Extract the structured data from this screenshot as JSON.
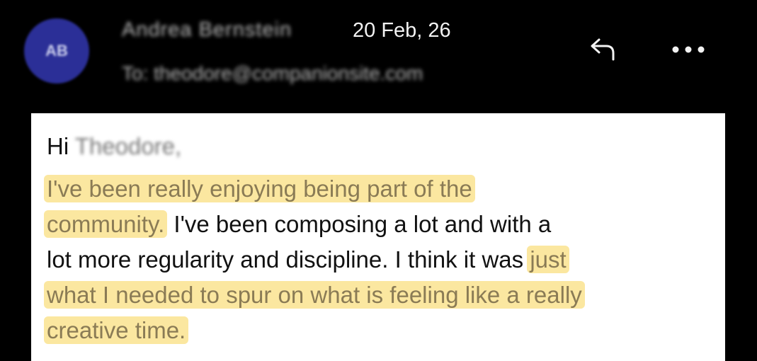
{
  "header": {
    "avatar_initials": "AB",
    "sender_name": "Andrea Bernstein",
    "date": "20 Feb, 26",
    "recipient": "To: theodore@companionsite.com",
    "reply_icon": "reply-icon",
    "more_icon": "more-options-icon"
  },
  "message": {
    "greeting_word": "Hi",
    "greeting_name": "Theodore,",
    "lines": [
      [
        {
          "text": "I've been really enjoying being part of the",
          "highlight": true
        }
      ],
      [
        {
          "text": "community.",
          "highlight": true
        },
        {
          "text": " I've been composing a lot and with a",
          "highlight": false
        }
      ],
      [
        {
          "text": "lot more regularity and discipline. I think it was ",
          "highlight": false
        },
        {
          "text": "just",
          "highlight": true
        }
      ],
      [
        {
          "text": "what I needed to spur on what is feeling like a really",
          "highlight": true
        }
      ],
      [
        {
          "text": "creative time.",
          "highlight": true
        }
      ]
    ]
  },
  "colors": {
    "background": "#000000",
    "avatar": "#2b2f97",
    "highlight": "#fbe7a0",
    "highlight_text": "#8a7b55",
    "card": "#ffffff"
  }
}
